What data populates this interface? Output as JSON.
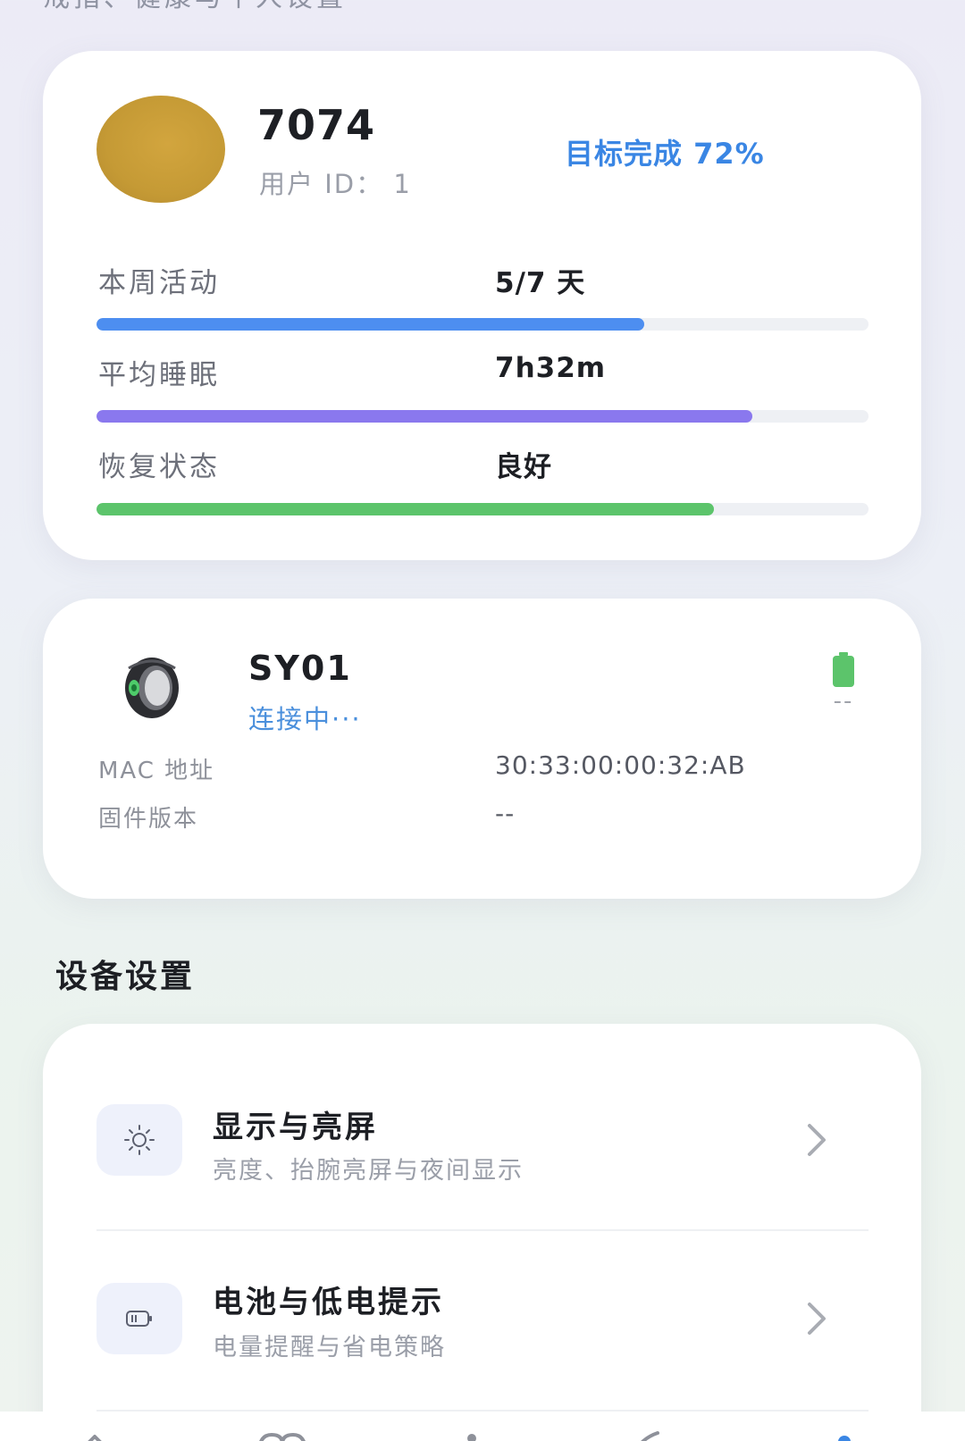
{
  "header": {
    "subtitle": "戒指、健康与个人设置"
  },
  "profile": {
    "username": "7074",
    "user_id": "用户 ID： 1",
    "goal": "目标完成 72%",
    "avatar_color": "#c9a13b",
    "stats": [
      {
        "label": "本周活动",
        "value": "5/7 天",
        "progress": 0.71,
        "color": "#4d8ef0"
      },
      {
        "label": "平均睡眠",
        "value": "7h32m",
        "progress": 0.85,
        "color": "#8a78ee"
      },
      {
        "label": "恢复状态",
        "value": "良好",
        "progress": 0.8,
        "color": "#5cc46b"
      }
    ]
  },
  "device": {
    "name": "SY01",
    "status": "连接中···",
    "battery_percent": "--",
    "battery_color": "#5cc46b",
    "info": [
      {
        "label": "MAC 地址",
        "value": "30:33:00:00:32:AB"
      },
      {
        "label": "固件版本",
        "value": "--"
      }
    ]
  },
  "settings": {
    "section_title": "设备设置",
    "items": [
      {
        "icon": "brightness-icon",
        "title": "显示与亮屏",
        "desc": "亮度、抬腕亮屏与夜间显示"
      },
      {
        "icon": "battery-setting-icon",
        "title": "电池与低电提示",
        "desc": "电量提醒与省电策略"
      }
    ]
  },
  "tabbar": {
    "icons": [
      "home-icon",
      "heart-icon",
      "activity-icon",
      "sleep-icon",
      "profile-icon"
    ],
    "active_color": "#3a86e4"
  }
}
